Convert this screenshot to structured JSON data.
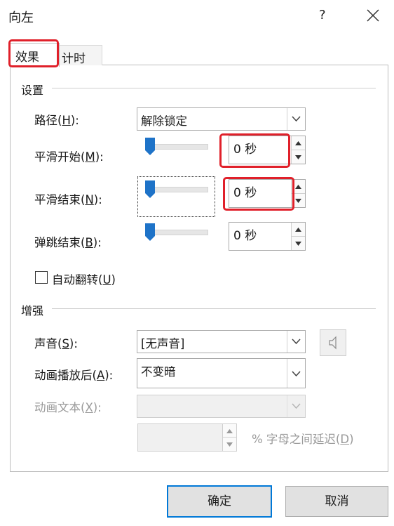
{
  "window": {
    "title": "向左",
    "help": "?",
    "close_icon": "close-icon"
  },
  "tabs": [
    {
      "label": "效果"
    },
    {
      "label": "计时"
    }
  ],
  "settings": {
    "group_label": "设置",
    "path": {
      "label_prefix": "路径(",
      "accel": "H",
      "label_suffix": "):",
      "value": "解除锁定"
    },
    "smooth_start": {
      "label_prefix": "平滑开始(",
      "accel": "M",
      "label_suffix": "):",
      "value": "0 秒",
      "level": 0
    },
    "smooth_end": {
      "label_prefix": "平滑结束(",
      "accel": "N",
      "label_suffix": "):",
      "value": "0 秒",
      "level": 0
    },
    "bounce_end": {
      "label_prefix": "弹跳结束(",
      "accel": "B",
      "label_suffix": "):",
      "value": "0 秒",
      "level": 0
    },
    "auto_reverse": {
      "label_prefix": "自动翻转(",
      "accel": "U",
      "label_suffix": ")",
      "checked": false
    }
  },
  "enhance": {
    "group_label": "增强",
    "sound": {
      "label_prefix": "声音(",
      "accel": "S",
      "label_suffix": "):",
      "value": "[无声音]"
    },
    "after_anim": {
      "label_prefix": "动画播放后(",
      "accel": "A",
      "label_suffix": "):",
      "value": "不变暗"
    },
    "anim_text": {
      "label_prefix": "动画文本(",
      "accel": "X",
      "label_suffix": "):",
      "value": ""
    },
    "delay": {
      "value": "",
      "label_prefix": "% 字母之间延迟(",
      "accel": "D",
      "label_suffix": ")"
    }
  },
  "footer": {
    "ok_label": "确定",
    "cancel_label": "取消"
  },
  "colors": {
    "highlight_red": "#e0202a",
    "slider_blue": "#1e73c8",
    "ok_border": "#0078d7"
  }
}
